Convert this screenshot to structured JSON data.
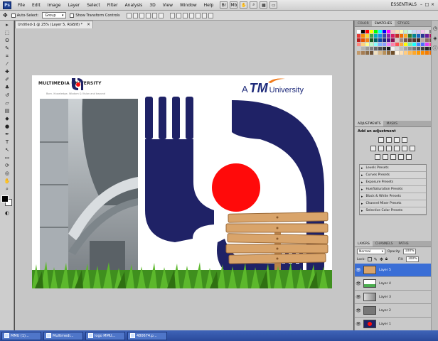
{
  "app": {
    "logo": "Ps",
    "menus": [
      "File",
      "Edit",
      "Image",
      "Layer",
      "Select",
      "Filter",
      "Analysis",
      "3D",
      "View",
      "Window",
      "Help"
    ],
    "workspace": "ESSENTIALS",
    "window_buttons": [
      "–",
      "□",
      "×"
    ]
  },
  "options_bar": {
    "auto_select_label": "Auto-Select:",
    "auto_select_value": "Group",
    "transform_label": "Show Transform Controls"
  },
  "document": {
    "tab_title": "Untitled-1 @ 25% (Layer 5, RGB/8) *",
    "close": "×"
  },
  "canvas": {
    "mmu_name": "MULTIMEDIA UNIVERSITY",
    "mmu_tagline": "Born. Knowledge, Wisdom & Vision and beyond",
    "tm_a": "A",
    "tm_mark": "TM",
    "tm_university": "University"
  },
  "swatches_panel": {
    "tabs": [
      "COLOR",
      "SWATCHES",
      "STYLES"
    ],
    "active_tab": 1,
    "colors": [
      "#ffffff",
      "#000000",
      "#ff0000",
      "#ffff00",
      "#00ff00",
      "#00ffff",
      "#0000ff",
      "#ff00ff",
      "#f5c6c6",
      "#f7e0b4",
      "#fffab0",
      "#c6f5c6",
      "#c6f5f5",
      "#c6d6f5",
      "#d8c6f5",
      "#f5c6ec",
      "#e6e6e6",
      "#808080",
      "#e53935",
      "#fb8c00",
      "#fdd835",
      "#43a047",
      "#00acc1",
      "#1e88e5",
      "#3949ab",
      "#8e24aa",
      "#d81b60",
      "#c62828",
      "#ef6c00",
      "#f9a825",
      "#2e7d32",
      "#00838f",
      "#1565c0",
      "#283593",
      "#6a1b9a",
      "#ad1457",
      "#b71c1c",
      "#e65100",
      "#f57f17",
      "#1b5e20",
      "#006064",
      "#0d47a1",
      "#1a237e",
      "#4a148c",
      "#880e4f",
      "#d7ccc8",
      "#a1887f",
      "#795548",
      "#5d4037",
      "#4e342e",
      "#3e2723",
      "#bcaaa4",
      "#8d6e63",
      "#6d4c41",
      "#ff8a80",
      "#ffd180",
      "#ffff8d",
      "#b9f6ca",
      "#84ffff",
      "#82b1ff",
      "#8c9eff",
      "#ea80fc",
      "#ff80ab",
      "#ff5252",
      "#ffab40",
      "#ffff00",
      "#69f0ae",
      "#18ffff",
      "#448aff",
      "#536dfe",
      "#e040fb",
      "#ff4081",
      "#cccccc",
      "#b3b3b3",
      "#999999",
      "#7f7f7f",
      "#666666",
      "#4c4c4c",
      "#333333",
      "#1a1a1a",
      "#f2f2f2",
      "#d9d9d9",
      "#bfbfbf",
      "#a6a6a6",
      "#8c8c8c",
      "#737373",
      "#595959",
      "#404040",
      "#262626",
      "#0d0d0d",
      "#c29a6b",
      "#a57c52",
      "#8b6b46",
      "#6e5236",
      "#f0e0c0",
      "#d8b98a",
      "#b89058",
      "#906a38",
      "#704f28",
      "#fff3e0",
      "#ffe0b2",
      "#ffcc80",
      "#ffb74d",
      "#ffa726",
      "#ff9800",
      "#fb8c00",
      "#f57c00",
      "#ef6c00"
    ]
  },
  "adjustments_panel": {
    "tabs": [
      "ADJUSTMENTS",
      "MASKS"
    ],
    "active_tab": 0,
    "title": "Add an adjustment",
    "presets": [
      "Levels Presets",
      "Curves Presets",
      "Exposure Presets",
      "Hue/Saturation Presets",
      "Black & White Presets",
      "Channel Mixer Presets",
      "Selective Color Presets"
    ]
  },
  "layers_panel": {
    "tabs": [
      "LAYERS",
      "CHANNELS",
      "PATHS"
    ],
    "active_tab": 0,
    "blend_mode": "Normal",
    "opacity_label": "Opacity:",
    "opacity_value": "100%",
    "lock_label": "Lock:",
    "fill_label": "Fill:",
    "fill_value": "100%",
    "layers": [
      "Layer 5",
      "Layer 4",
      "Layer 3",
      "Layer 2",
      "Layer 1"
    ],
    "selected_index": 0
  },
  "taskbar": {
    "items": [
      "MMU (1)...",
      "Multimedi...",
      "logo MMU...",
      "480674.p..."
    ]
  },
  "colors": {
    "mmu_blue": "#1f2266",
    "mmu_red": "#ff0a0a",
    "tm_blue": "#1e2a7a",
    "selection_blue": "#3a6ed6",
    "wood": "#d9a46a"
  }
}
